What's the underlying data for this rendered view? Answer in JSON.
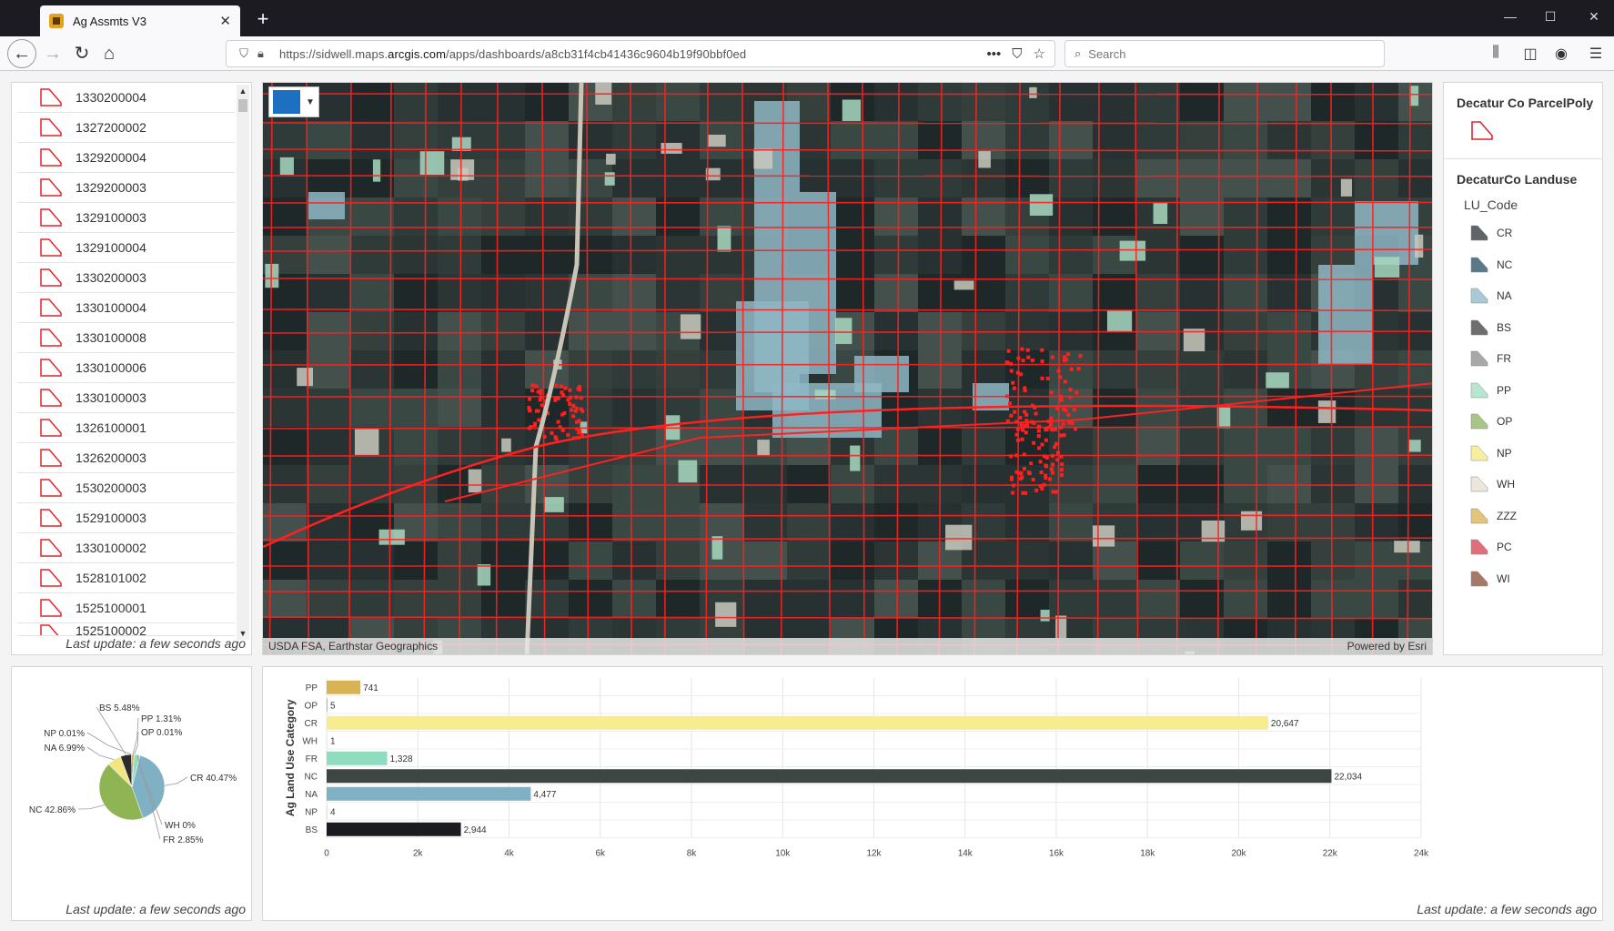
{
  "browser": {
    "tab_title": "Ag Assmts V3",
    "tab_close": "✕",
    "new_tab": "+",
    "url_prefix": "https://sidwell.maps.",
    "url_domain": "arcgis.com",
    "url_path": "/apps/dashboards/a8cb31f4cb41436c9604b19f90bbf0ed",
    "search_placeholder": "Search"
  },
  "parcel_list": {
    "items": [
      "1330200004",
      "1327200002",
      "1329200004",
      "1329200003",
      "1329100003",
      "1329100004",
      "1330200003",
      "1330100004",
      "1330100008",
      "1330100006",
      "1330100003",
      "1326100001",
      "1326200003",
      "1530200003",
      "1529100003",
      "1330100002",
      "1528101002",
      "1525100001",
      "1525100002"
    ],
    "last_update": "Last update: a few seconds ago"
  },
  "map": {
    "attribution_left": "USDA FSA, Earthstar Geographics",
    "attribution_right": "Powered by Esri",
    "parcel_color": "#ff2020"
  },
  "legend": {
    "layer1_title": "Decatur Co ParcelPoly",
    "layer2_title": "DecaturCo Landuse",
    "field_name": "LU_Code",
    "items": [
      {
        "code": "CR",
        "color": "#5f6468"
      },
      {
        "code": "NC",
        "color": "#5a7888"
      },
      {
        "code": "NA",
        "color": "#a9c9d6"
      },
      {
        "code": "BS",
        "color": "#6e6e6e"
      },
      {
        "code": "FR",
        "color": "#a8a8a8"
      },
      {
        "code": "PP",
        "color": "#b6e6d2"
      },
      {
        "code": "OP",
        "color": "#a6c587"
      },
      {
        "code": "NP",
        "color": "#f7ef9f"
      },
      {
        "code": "WH",
        "color": "#ede6dc"
      },
      {
        "code": "ZZZ",
        "color": "#e2c57a"
      },
      {
        "code": "PC",
        "color": "#df6e7a"
      },
      {
        "code": "WI",
        "color": "#a87866"
      }
    ]
  },
  "pie_chart": {
    "last_update": "Last update: a few seconds ago"
  },
  "bar_chart": {
    "last_update": "Last update: a few seconds ago"
  },
  "chart_data": [
    {
      "type": "pie",
      "slices": [
        {
          "label": "CR",
          "value": 40.47,
          "display": "CR 40.47%",
          "color": "#7fb0c4"
        },
        {
          "label": "NC",
          "value": 42.86,
          "display": "NC 42.86%",
          "color": "#8fb454"
        },
        {
          "label": "NA",
          "value": 6.99,
          "display": "NA 6.99%",
          "color": "#f3e582"
        },
        {
          "label": "BS",
          "value": 5.48,
          "display": "BS 5.48%",
          "color": "#2b2b2b"
        },
        {
          "label": "NP",
          "value": 0.01,
          "display": "NP 0.01%",
          "color": "#f0e6a0"
        },
        {
          "label": "PP",
          "value": 1.31,
          "display": "PP 1.31%",
          "color": "#d9b353"
        },
        {
          "label": "OP",
          "value": 0.01,
          "display": "OP 0.01%",
          "color": "#a6c587"
        },
        {
          "label": "WH",
          "value": 0.0,
          "display": "WH 0%",
          "color": "#eee"
        },
        {
          "label": "FR",
          "value": 2.85,
          "display": "FR 2.85%",
          "color": "#8fdcbf"
        }
      ]
    },
    {
      "type": "bar",
      "orientation": "horizontal",
      "ylabel": "Ag Land Use Category",
      "categories": [
        "PP",
        "OP",
        "CR",
        "WH",
        "FR",
        "NC",
        "NA",
        "NP",
        "BS"
      ],
      "values": [
        741,
        5,
        20647,
        1,
        1328,
        22034,
        4477,
        4,
        2944
      ],
      "value_labels": [
        "741",
        "5",
        "20,647",
        "1",
        "1,328",
        "22,034",
        "4,477",
        "4",
        "2,944"
      ],
      "colors": [
        "#d9b353",
        "#a6c587",
        "#f7ec8f",
        "#eee",
        "#8fdcbf",
        "#3e4644",
        "#7fb0c4",
        "#f0e6a0",
        "#1b1c22"
      ],
      "xlim": [
        0,
        24000
      ],
      "xticks": [
        "0",
        "2k",
        "4k",
        "6k",
        "8k",
        "10k",
        "12k",
        "14k",
        "16k",
        "18k",
        "20k",
        "22k",
        "24k"
      ]
    }
  ]
}
